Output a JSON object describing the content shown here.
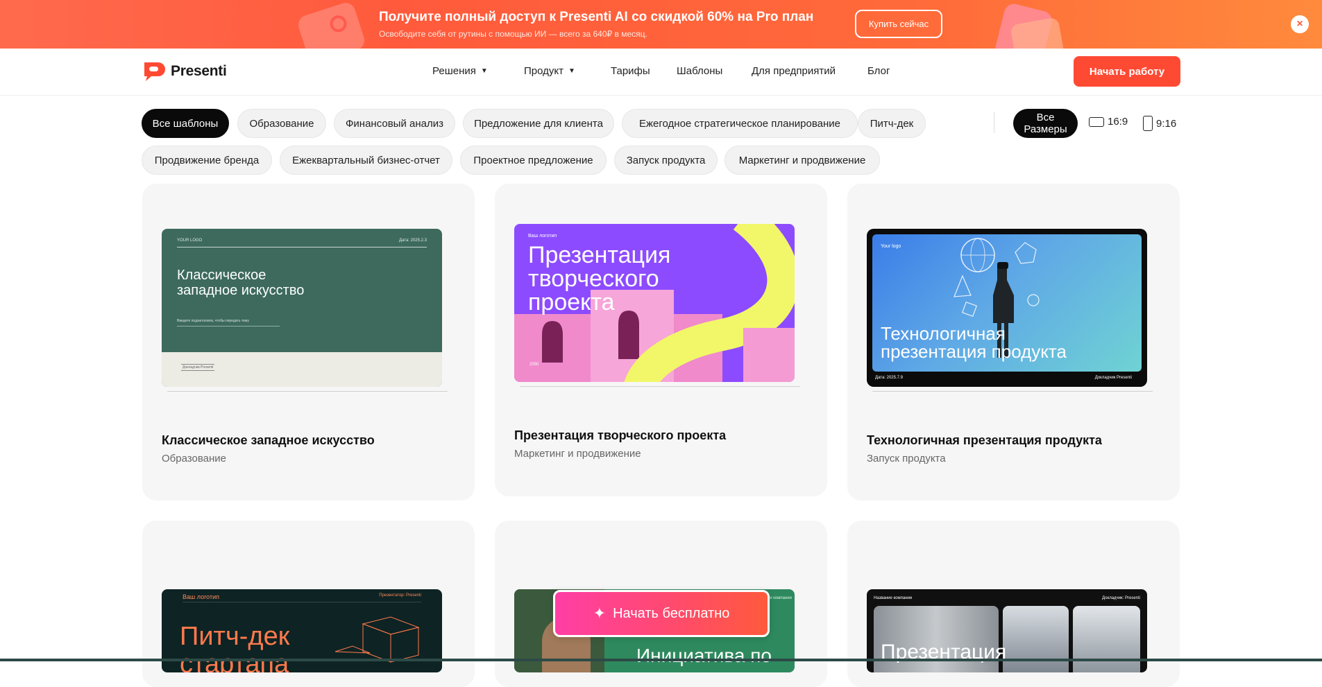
{
  "promo": {
    "title": "Получите полный доступ к Presenti AI со скидкой 60% на Pro план",
    "subtitle": "Освободите себя от рутины с помощью ИИ — всего за 640₽ в месяц.",
    "button_label": "Купить сейчас",
    "close_glyph": "×"
  },
  "header": {
    "logo_text": "Presenti",
    "nav": [
      {
        "label": "Решения",
        "has_dropdown": true
      },
      {
        "label": "Продукт",
        "has_dropdown": true
      },
      {
        "label": "Тарифы",
        "has_dropdown": false
      },
      {
        "label": "Шаблоны",
        "has_dropdown": false
      },
      {
        "label": "Для предприятий",
        "has_dropdown": false
      },
      {
        "label": "Блог",
        "has_dropdown": false
      }
    ],
    "cta_label": "Начать работу"
  },
  "filters": {
    "categories": [
      {
        "label": "Все шаблоны",
        "active": true
      },
      {
        "label": "Образование",
        "active": false
      },
      {
        "label": "Финансовый анализ",
        "active": false
      },
      {
        "label": "Предложение для клиента",
        "active": false
      },
      {
        "label": "Ежегодное стратегическое планирование",
        "active": false
      },
      {
        "label": "Питч-дек",
        "active": false
      },
      {
        "label": "Продвижение бренда",
        "active": false
      },
      {
        "label": "Ежеквартальный бизнес-отчет",
        "active": false
      },
      {
        "label": "Проектное предложение",
        "active": false
      },
      {
        "label": "Запуск продукта",
        "active": false
      },
      {
        "label": "Маркетинг и продвижение",
        "active": false
      }
    ],
    "sizes": {
      "all_line1": "Все",
      "all_line2": "Размеры",
      "ratio_wide": "16:9",
      "ratio_tall": "9:16"
    }
  },
  "templates": [
    {
      "title": "Классическое западное искусство",
      "category": "Образование",
      "thumb": {
        "logo": "YOUR LOGO",
        "date": "Дата: 2025.2.3",
        "heading_line1": "Классическое",
        "heading_line2": "западное искусство",
        "subtext": "Введите подзаголовок, чтобы передать тему",
        "footer": "Докладчик Presenti"
      }
    },
    {
      "title": "Презентация творческого проекта",
      "category": "Маркетинг и продвижение",
      "thumb": {
        "logo": "Ваш логотип",
        "heading_line1": "Презентация",
        "heading_line2": "творческого",
        "heading_line3": "проекта",
        "year": "2050"
      }
    },
    {
      "title": "Технологичная презентация продукта",
      "category": "Запуск продукта",
      "thumb": {
        "logo": "Your logo",
        "heading_line1": "Технологичная",
        "heading_line2": "презентация продукта",
        "date": "Дата: 2025.7.9",
        "speaker": "Докладчик Presenti"
      }
    },
    {
      "thumb": {
        "logo": "Ваш логотип",
        "speaker": "Презентатор: Presenti",
        "heading_line1": "Питч-дек",
        "heading_line2": "стартапа"
      }
    },
    {
      "thumb": {
        "logo": "Название компании",
        "heading_line1": "Инициатива по"
      }
    },
    {
      "thumb": {
        "logo": "Название компании",
        "speaker": "Докладчик: Presenti",
        "heading_line1": "Презентация"
      }
    }
  ],
  "floating_cta": {
    "label": "Начать бесплатно",
    "icon": "sparkle-icon"
  },
  "colors": {
    "accent": "#ff4a33",
    "banner_start": "#ff6a4d",
    "banner_end": "#ff8a3c",
    "chip_bg": "#f2f2f2",
    "card_bg": "#f6f6f6"
  }
}
